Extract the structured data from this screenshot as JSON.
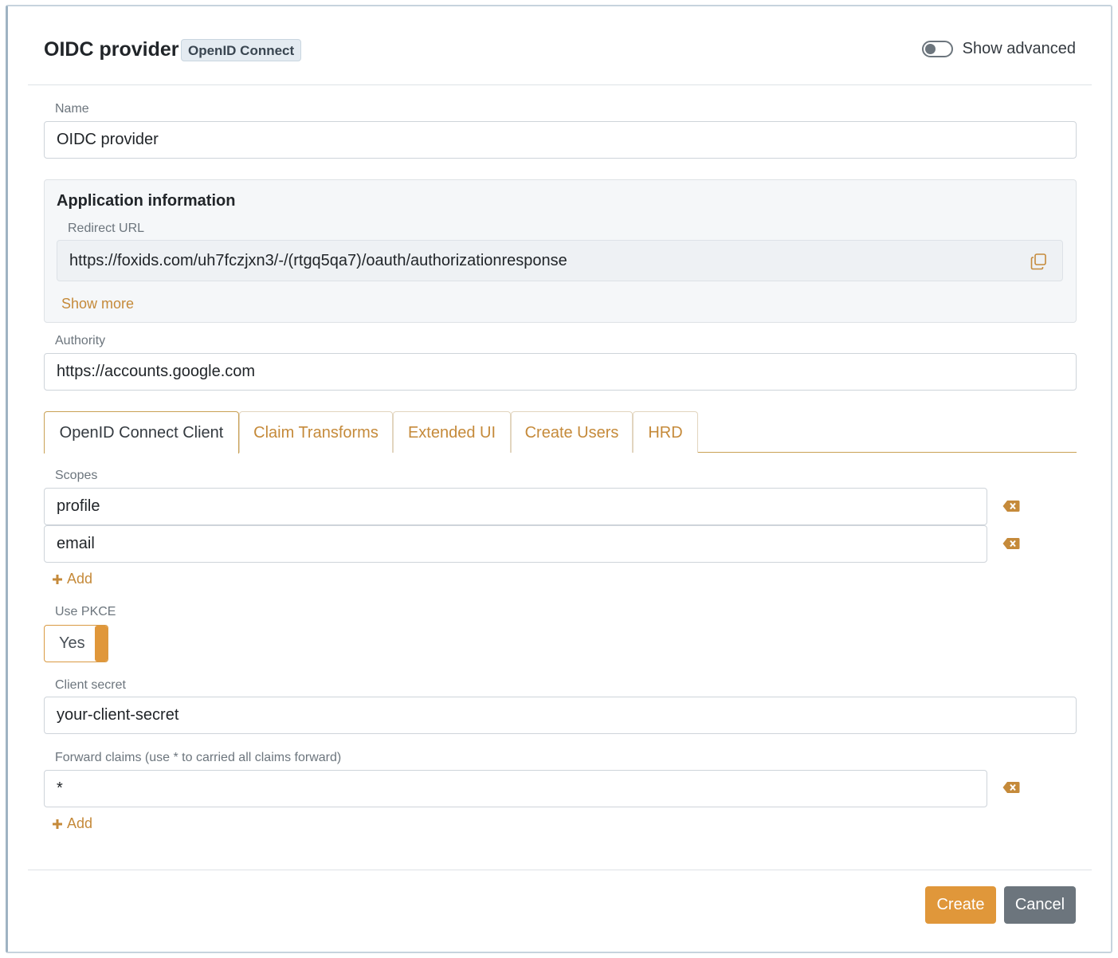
{
  "header": {
    "title": "OIDC provider",
    "badge": "OpenID Connect",
    "show_advanced_label": "Show advanced"
  },
  "name": {
    "label": "Name",
    "value": "OIDC provider"
  },
  "app_info": {
    "title": "Application information",
    "redirect_label": "Redirect URL",
    "redirect_url": "https://foxids.com/uh7fczjxn3/-/(rtgq5qa7)/oauth/authorizationresponse",
    "show_more": "Show more"
  },
  "authority": {
    "label": "Authority",
    "value": "https://accounts.google.com"
  },
  "tabs": [
    {
      "label": "OpenID Connect Client",
      "active": true
    },
    {
      "label": "Claim Transforms",
      "active": false
    },
    {
      "label": "Extended UI",
      "active": false
    },
    {
      "label": "Create Users",
      "active": false
    },
    {
      "label": "HRD",
      "active": false
    }
  ],
  "scopes": {
    "label": "Scopes",
    "items": [
      "profile",
      "email"
    ],
    "add_label": "Add"
  },
  "pkce": {
    "label": "Use PKCE",
    "value": "Yes"
  },
  "client_secret": {
    "label": "Client secret",
    "value": "your-client-secret"
  },
  "forward_claims": {
    "label": "Forward claims (use * to carried all claims forward)",
    "items": [
      "*"
    ],
    "add_label": "Add"
  },
  "actions": {
    "create": "Create",
    "cancel": "Cancel"
  },
  "colors": {
    "accent": "#e0973a",
    "link": "#c58a3a",
    "secondary": "#6c757d"
  }
}
